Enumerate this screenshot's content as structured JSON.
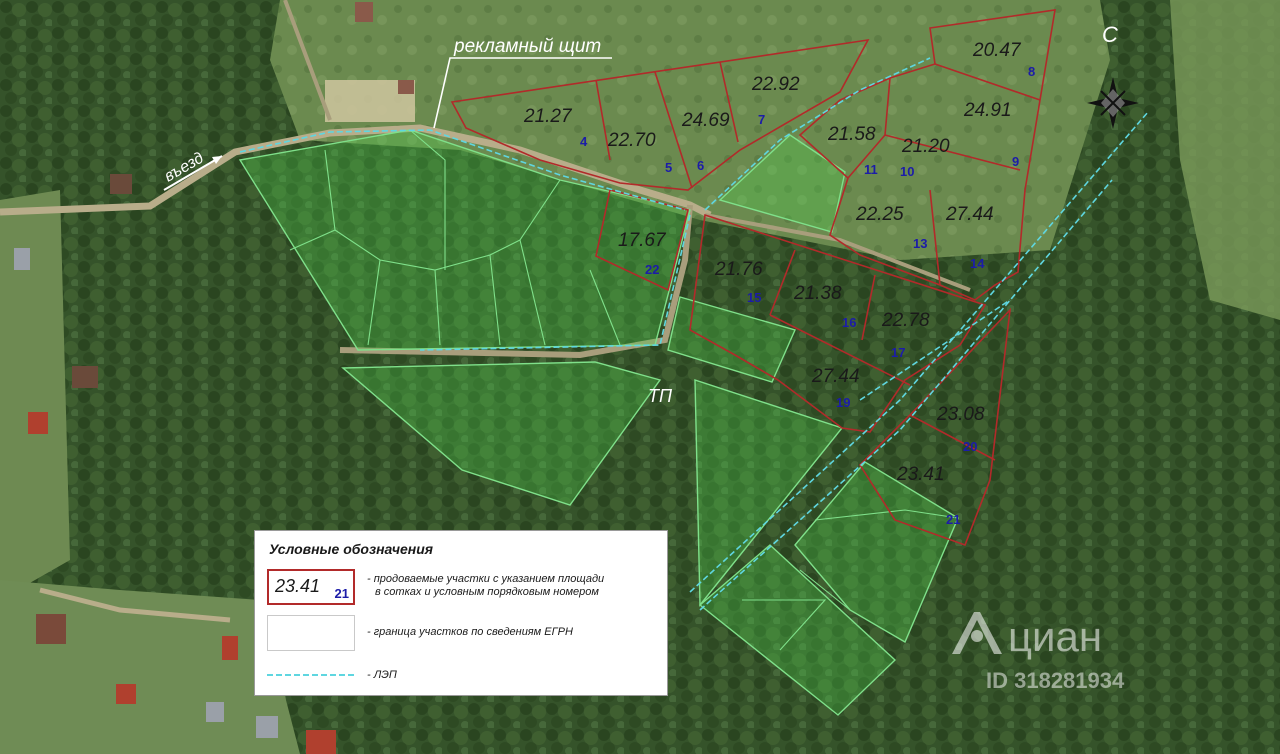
{
  "map": {
    "north_label": "С",
    "entrance_label": "въезд",
    "billboard_label": "рекламный щит",
    "substation_label": "ТП",
    "colors": {
      "sale_border": "#b22a2a",
      "egrn_border": "#7fe08a",
      "egrn_fill": "#4fd04f",
      "power_line": "#5fd6e0",
      "plot_number": "#1c1ca8"
    },
    "plots_for_sale": [
      {
        "area": "21.27",
        "num": "4"
      },
      {
        "area": "22.70",
        "num": "5"
      },
      {
        "area": "24.69",
        "num": "6"
      },
      {
        "area": "22.92",
        "num": "7"
      },
      {
        "area": "20.47",
        "num": "8"
      },
      {
        "area": "24.91",
        "num": "9"
      },
      {
        "area": "21.20",
        "num": "10"
      },
      {
        "area": "21.58",
        "num": "11"
      },
      {
        "area": "22.25",
        "num": "13"
      },
      {
        "area": "27.44",
        "num": "14"
      },
      {
        "area": "21.76",
        "num": "15"
      },
      {
        "area": "21.38",
        "num": "16"
      },
      {
        "area": "22.78",
        "num": "17"
      },
      {
        "area": "27.44",
        "num": "19"
      },
      {
        "area": "23.08",
        "num": "20"
      },
      {
        "area": "23.41",
        "num": "21"
      },
      {
        "area": "17.67",
        "num": "22"
      }
    ]
  },
  "legend": {
    "title": "Условные обозначения",
    "sample_area": "23.41",
    "sample_num": "21",
    "sale_text_line1": "- продоваемые участки с указанием площади",
    "sale_text_line2": "в сотках и условным порядковым номером",
    "egrn_text": "- граница участков по сведениям ЕГРН",
    "lep_text": "- ЛЭП"
  },
  "watermark": {
    "brand": "циан",
    "id_text": "ID 318281934"
  }
}
